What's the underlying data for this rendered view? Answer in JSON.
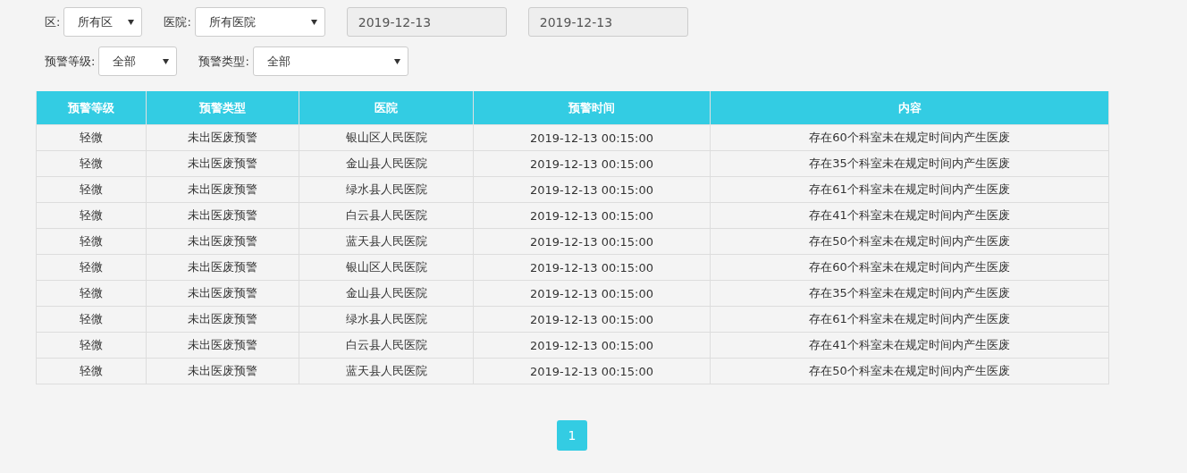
{
  "filters": {
    "row_1": [
      {
        "kind": "select",
        "label": "区:",
        "value": "所有区"
      },
      {
        "kind": "select",
        "label": "医院:",
        "value": "所有医院"
      },
      {
        "kind": "date",
        "value": "2019-12-13",
        "disabled": true
      },
      {
        "kind": "date",
        "value": "2019-12-13",
        "disabled": true
      }
    ],
    "row_2": [
      {
        "kind": "select",
        "label": "预警等级:",
        "value": "全部"
      },
      {
        "kind": "select",
        "label": "预警类型:",
        "value": "全部"
      }
    ]
  },
  "table": {
    "columns": [
      "预警等级",
      "预警类型",
      "医院",
      "预警时间",
      "内容"
    ],
    "rows": [
      [
        "轻微",
        "未出医废预警",
        "银山区人民医院",
        "2019-12-13 00:15:00",
        "存在60个科室未在规定时间内产生医废"
      ],
      [
        "轻微",
        "未出医废预警",
        "金山县人民医院",
        "2019-12-13 00:15:00",
        "存在35个科室未在规定时间内产生医废"
      ],
      [
        "轻微",
        "未出医废预警",
        "绿水县人民医院",
        "2019-12-13 00:15:00",
        "存在61个科室未在规定时间内产生医废"
      ],
      [
        "轻微",
        "未出医废预警",
        "白云县人民医院",
        "2019-12-13 00:15:00",
        "存在41个科室未在规定时间内产生医废"
      ],
      [
        "轻微",
        "未出医废预警",
        "蓝天县人民医院",
        "2019-12-13 00:15:00",
        "存在50个科室未在规定时间内产生医废"
      ],
      [
        "轻微",
        "未出医废预警",
        "银山区人民医院",
        "2019-12-13 00:15:00",
        "存在60个科室未在规定时间内产生医废"
      ],
      [
        "轻微",
        "未出医废预警",
        "金山县人民医院",
        "2019-12-13 00:15:00",
        "存在35个科室未在规定时间内产生医废"
      ],
      [
        "轻微",
        "未出医废预警",
        "绿水县人民医院",
        "2019-12-13 00:15:00",
        "存在61个科室未在规定时间内产生医废"
      ],
      [
        "轻微",
        "未出医废预警",
        "白云县人民医院",
        "2019-12-13 00:15:00",
        "存在41个科室未在规定时间内产生医废"
      ],
      [
        "轻微",
        "未出医废预警",
        "蓝天县人民医院",
        "2019-12-13 00:15:00",
        "存在50个科室未在规定时间内产生医废"
      ]
    ]
  },
  "pagination": [
    {
      "label": "1",
      "selected": true
    }
  ]
}
